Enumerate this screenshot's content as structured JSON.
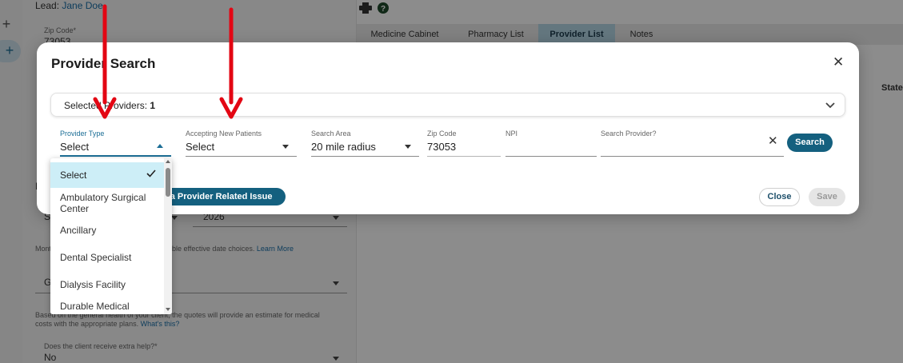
{
  "background": {
    "lead_label": "Lead:",
    "lead_name": "Jane Doe",
    "zip_label": "Zip Code*",
    "zip_value": "73053",
    "year_value": "2026",
    "effective_note_prefix": "Mont",
    "effective_note_suffix": "ble effective date choices.",
    "learn_more": "Learn More",
    "health_partial": "G",
    "health_note": "costs with the appropriate plans.",
    "health_note_top": "Based on the general health of your client, the quotes will provide an estimate for medical",
    "whats_this": "What's this?",
    "extra_help_label": "Does the client receive extra help?*",
    "extra_help_value": "No",
    "partial_s": "S",
    "partial_p": "P",
    "tabs": [
      {
        "label": "Medicine Cabinet",
        "active": false
      },
      {
        "label": "Pharmacy List",
        "active": false
      },
      {
        "label": "Provider List",
        "active": true
      },
      {
        "label": "Notes",
        "active": false
      }
    ],
    "state_header": "State"
  },
  "modal": {
    "title": "Provider Search",
    "selected_label": "Selected Providers:",
    "selected_count": "1",
    "fields": {
      "provider_type": {
        "label": "Provider Type",
        "value": "Select"
      },
      "accepting": {
        "label": "Accepting New Patients",
        "value": "Select"
      },
      "search_area": {
        "label": "Search Area",
        "value": "20 mile radius"
      },
      "zip": {
        "label": "Zip Code",
        "value": "73053"
      },
      "npi": {
        "label": "NPI",
        "value": ""
      },
      "search_provider": {
        "label": "Search Provider?",
        "value": ""
      }
    },
    "search_button": "Search",
    "report_button": "t a Provider Related Issue",
    "close_button": "Close",
    "save_button": "Save"
  },
  "dropdown": {
    "items": [
      {
        "label": "Select",
        "selected": true
      },
      {
        "label": "Ambulatory Surgical Center",
        "selected": false
      },
      {
        "label": "Ancillary",
        "selected": false
      },
      {
        "label": "Dental Specialist",
        "selected": false
      },
      {
        "label": "Dialysis Facility",
        "selected": false
      },
      {
        "label": "Durable Medical",
        "selected": false
      }
    ]
  },
  "colors": {
    "accent": "#14607f",
    "annotation_arrow": "#e30613",
    "dropdown_selected": "#cdeef7"
  },
  "icons": {
    "print": "print-icon",
    "help": "help-icon",
    "close": "close-icon",
    "chevron": "chevron-down-icon",
    "check": "check-icon",
    "clear": "clear-icon",
    "add": "plus-icon"
  }
}
